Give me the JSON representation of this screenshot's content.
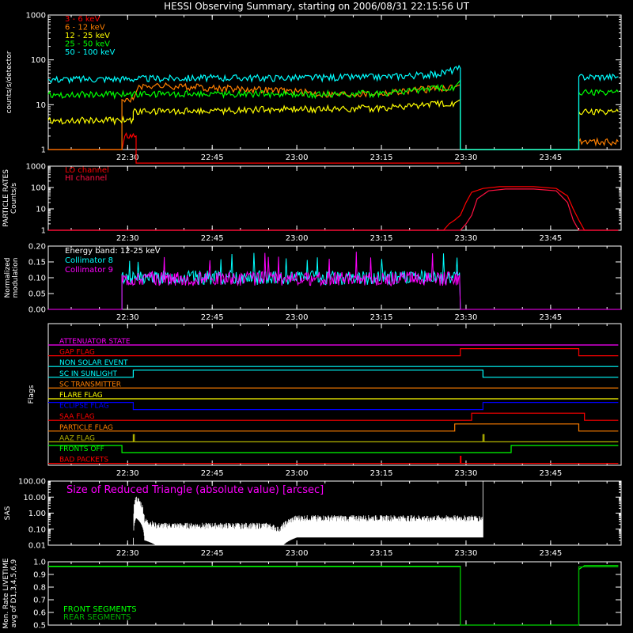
{
  "title": "HESSI Observing Summary, starting on 2006/08/31 22:15:56 UT",
  "time_axis": {
    "start": "22:15:56",
    "end": "23:57:30",
    "ticks": [
      "22:30",
      "22:45",
      "23:00",
      "23:15",
      "23:30",
      "23:45"
    ],
    "tick_minutes": [
      30,
      45,
      60,
      75,
      90,
      105
    ]
  },
  "chart_data": [
    {
      "id": "counts",
      "type": "line",
      "ylabel": "counts/s/detector",
      "scale": "log",
      "ylim": [
        1,
        1000
      ],
      "yticks": [
        "1",
        "10",
        "100",
        "1000"
      ],
      "legend_position": "top-left",
      "series": [
        {
          "name": "3 - 6 keV",
          "color": "#ff0000",
          "x": [
            "22:15:56",
            "22:29",
            "22:29.5",
            "22:31.5",
            "22:31.5",
            "23:29"
          ],
          "values": [
            1,
            1,
            2,
            2,
            0.5,
            0.5
          ]
        },
        {
          "name": "6 - 12 keV",
          "color": "#ff7f00",
          "x": [
            "22:15:56",
            "22:29",
            "22:29",
            "22:31",
            "22:32",
            "22:45",
            "23:00",
            "23:05",
            "23:15",
            "23:28",
            "23:29",
            "23:29",
            "23:50",
            "23:50",
            "23:57"
          ],
          "values": [
            1,
            1,
            13,
            13,
            27,
            24,
            20,
            17,
            18,
            25,
            28,
            1,
            1,
            1.5,
            1.5
          ]
        },
        {
          "name": "12 - 25 keV",
          "color": "#ffff00",
          "x": [
            "22:15:56",
            "22:31",
            "22:31",
            "22:45",
            "23:00",
            "23:15",
            "23:28",
            "23:29",
            "23:29",
            "23:50",
            "23:50",
            "23:57"
          ],
          "values": [
            4.5,
            4.5,
            7,
            7.5,
            8,
            8.5,
            11,
            13,
            1,
            1,
            7,
            7
          ]
        },
        {
          "name": "25 - 50 keV",
          "color": "#00ff00",
          "x": [
            "22:15:56",
            "22:30",
            "22:45",
            "23:00",
            "23:15",
            "23:28",
            "23:29",
            "23:29",
            "23:50",
            "23:50",
            "23:57"
          ],
          "values": [
            17,
            17,
            18,
            17,
            18,
            25,
            35,
            1,
            1,
            19,
            19
          ]
        },
        {
          "name": "50 - 100 keV",
          "color": "#00ffff",
          "x": [
            "22:15:56",
            "22:30",
            "22:45",
            "23:00",
            "23:15",
            "23:25",
            "23:29",
            "23:29",
            "23:50",
            "23:50",
            "23:57"
          ],
          "values": [
            37,
            38,
            40,
            40,
            42,
            48,
            65,
            1,
            1,
            42,
            42
          ]
        }
      ]
    },
    {
      "id": "particles",
      "type": "line",
      "ylabel": "PARTICLE RATES Counts/s",
      "scale": "log",
      "ylim": [
        1,
        1000
      ],
      "yticks": [
        "1",
        "10",
        "100",
        "1000"
      ],
      "legend_position": "top-left",
      "series": [
        {
          "name": "LO channel",
          "color": "#ff0000",
          "x": [
            "22:15:56",
            "23:26",
            "23:27",
            "23:28",
            "23:29",
            "23:30",
            "23:31",
            "23:33",
            "23:36",
            "23:42",
            "23:46",
            "23:48",
            "23:49",
            "23:50",
            "23:51",
            "23:57"
          ],
          "values": [
            1,
            1,
            2,
            3,
            5,
            20,
            60,
            90,
            110,
            110,
            90,
            40,
            10,
            3,
            1,
            1
          ]
        },
        {
          "name": "HI channel",
          "color": "#ff1040",
          "x": [
            "22:15:56",
            "23:29",
            "23:30",
            "23:31",
            "23:32",
            "23:34",
            "23:37",
            "23:42",
            "23:46",
            "23:48",
            "23:49",
            "23:50",
            "23:57"
          ],
          "values": [
            1,
            1,
            2,
            5,
            30,
            70,
            85,
            85,
            70,
            20,
            3,
            1,
            1
          ]
        }
      ]
    },
    {
      "id": "modulation",
      "type": "line",
      "ylabel": "Normalized modulation",
      "ylim": [
        0,
        0.2
      ],
      "yticks": [
        "0.00",
        "0.05",
        "0.10",
        "0.15",
        "0.20"
      ],
      "legend_position": "top-left",
      "annotation": "Energy band: 12-25 keV",
      "series": [
        {
          "name": "Collimator 8",
          "color": "#00ffff",
          "x_start": "22:29",
          "x_end": "23:29",
          "mean": 0.1
        },
        {
          "name": "Collimator 9",
          "color": "#ff00ff",
          "x_start": "22:29",
          "x_end": "23:29",
          "mean": 0.097
        }
      ]
    },
    {
      "id": "flags",
      "type": "line",
      "ylabel": "Flags",
      "rows": [
        {
          "name": "ATTENUATOR STATE",
          "color": "#ff00ff",
          "x": [
            "22:15:56",
            "23:57"
          ],
          "values": [
            0,
            0
          ]
        },
        {
          "name": "GAP FLAG",
          "color": "#ff0000",
          "x": [
            "22:15:56",
            "23:29",
            "23:29",
            "23:50",
            "23:50",
            "23:57"
          ],
          "values": [
            0,
            0,
            1,
            1,
            0,
            0
          ]
        },
        {
          "name": "NON SOLAR EVENT",
          "color": "#00ffff",
          "x": [
            "22:15:56",
            "23:57"
          ],
          "values": [
            0,
            0
          ]
        },
        {
          "name": "SC IN SUNLIGHT",
          "color": "#00ffff",
          "x": [
            "22:15:56",
            "22:31",
            "22:31",
            "23:33",
            "23:33",
            "23:57"
          ],
          "values": [
            0,
            0,
            1,
            1,
            0,
            0
          ]
        },
        {
          "name": "SC TRANSMITTER",
          "color": "#ff7f00",
          "x": [
            "22:15:56",
            "23:57"
          ],
          "values": [
            0,
            0
          ]
        },
        {
          "name": "FLARE FLAG",
          "color": "#ffff00",
          "x": [
            "22:15:56",
            "23:57"
          ],
          "values": [
            0,
            0
          ]
        },
        {
          "name": "ECLIPSE FLAG",
          "color": "#0000ff",
          "x": [
            "22:15:56",
            "22:31",
            "22:31",
            "23:33",
            "23:33",
            "23:57"
          ],
          "values": [
            1,
            1,
            0,
            0,
            1,
            1
          ]
        },
        {
          "name": "SAA FLAG",
          "color": "#ff0000",
          "x": [
            "22:15:56",
            "23:31",
            "23:31",
            "23:51",
            "23:51",
            "23:57"
          ],
          "values": [
            0,
            0,
            1,
            1,
            0,
            0
          ]
        },
        {
          "name": "PARTICLE FLAG",
          "color": "#ff7f00",
          "x": [
            "22:15:56",
            "23:28",
            "23:28",
            "23:50",
            "23:50",
            "23:57"
          ],
          "values": [
            0,
            0,
            1,
            1,
            0,
            0
          ]
        },
        {
          "name": "AAZ FLAG",
          "color": "#b5b500",
          "x": [
            "22:15:56",
            "22:31",
            "22:31",
            "22:31.2",
            "22:31.2",
            "23:33",
            "23:33",
            "23:33.2",
            "23:33.2",
            "23:57"
          ],
          "values": [
            0,
            0,
            1,
            1,
            0,
            0,
            1,
            1,
            0,
            0
          ]
        },
        {
          "name": "FRONTS OFF",
          "color": "#00ff00",
          "x": [
            "22:15:56",
            "22:29",
            "22:29",
            "23:38",
            "23:38",
            "23:57"
          ],
          "values": [
            1,
            1,
            0,
            0,
            1,
            1
          ]
        },
        {
          "name": "BAD PACKETS",
          "color": "#ff0000",
          "x": [
            "22:15:56",
            "23:29",
            "23:29",
            "23:29.1",
            "23:29.1",
            "23:57"
          ],
          "values": [
            0,
            0,
            1,
            1,
            0,
            0
          ]
        }
      ]
    },
    {
      "id": "sas",
      "type": "line",
      "ylabel": "SAS",
      "scale": "log",
      "ylim": [
        0.01,
        100
      ],
      "yticks": [
        "0.01",
        "0.10",
        "1.00",
        "10.00",
        "100.00"
      ],
      "title": "Size of Reduced Triangle (absolute value) [arcsec]",
      "title_color": "#ff00ff",
      "series": [
        {
          "name": "SAS",
          "color": "#ffffff",
          "x": [
            "22:31",
            "22:31.5",
            "22:33",
            "22:35",
            "22:55",
            "22:57",
            "23:00",
            "23:15",
            "23:33",
            "23:33"
          ],
          "values": [
            0.02,
            5,
            0.2,
            0.1,
            0.1,
            0.05,
            0.3,
            0.3,
            0.3,
            100
          ]
        }
      ]
    },
    {
      "id": "livetime",
      "type": "line",
      "ylabel": "Mon. Rate LIVETIME avg of D1,3,4,5,6,9",
      "ylim": [
        0.5,
        1.0
      ],
      "yticks": [
        "0.5",
        "0.6",
        "0.7",
        "0.8",
        "0.9",
        "1.0"
      ],
      "legend_position": "bottom-left",
      "series": [
        {
          "name": "FRONT SEGMENTS",
          "color": "#00ff00",
          "x": [
            "22:15:56",
            "23:29",
            "23:29",
            "23:50",
            "23:50",
            "23:51",
            "23:57"
          ],
          "values": [
            0.965,
            0.965,
            0.5,
            0.5,
            0.94,
            0.97,
            0.97
          ]
        },
        {
          "name": "REAR SEGMENTS",
          "color": "#00b000",
          "x": [
            "22:15:56",
            "23:29",
            "23:29",
            "23:50",
            "23:50",
            "23:57"
          ],
          "values": [
            0.96,
            0.96,
            0.5,
            0.5,
            0.96,
            0.96
          ]
        }
      ]
    }
  ]
}
